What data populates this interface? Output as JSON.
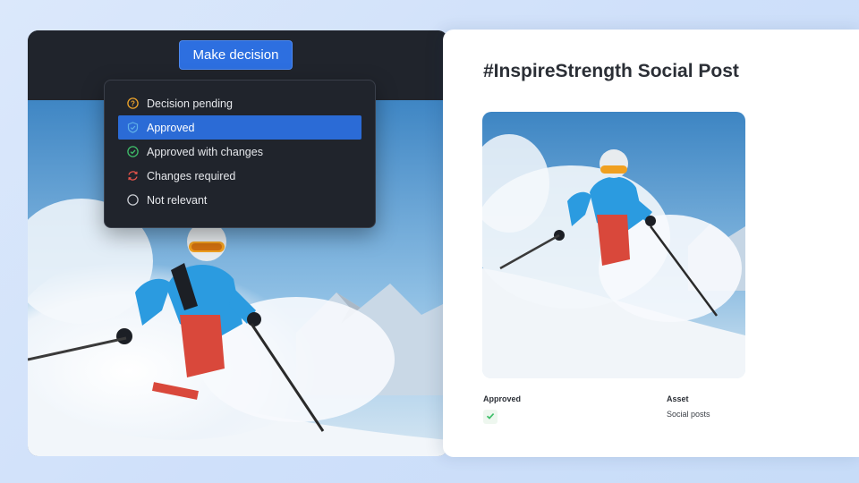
{
  "decision_button": {
    "label": "Make decision"
  },
  "dropdown": {
    "items": [
      {
        "label": "Decision pending",
        "icon": "question-circle-icon",
        "color": "#f0a52a"
      },
      {
        "label": "Approved",
        "icon": "shield-check-icon",
        "color": "#5fb0e8",
        "selected": true
      },
      {
        "label": "Approved with changes",
        "icon": "check-circle-icon",
        "color": "#3fbf6a"
      },
      {
        "label": "Changes required",
        "icon": "refresh-icon",
        "color": "#e5534b"
      },
      {
        "label": "Not relevant",
        "icon": "empty-circle-icon",
        "color": "#c9ccd2"
      }
    ]
  },
  "post": {
    "title": "#InspireStrength Social Post",
    "status_label": "Approved",
    "status_icon": "check-icon",
    "asset_label": "Asset",
    "asset_value": "Social posts"
  },
  "colors": {
    "accent": "#2d6fe0",
    "panel_dark": "#20242c",
    "approved_green": "#3fbf6a"
  }
}
